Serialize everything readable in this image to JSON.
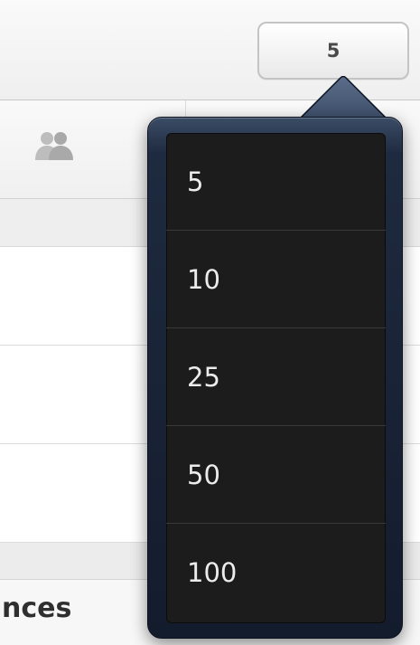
{
  "toolbar": {
    "page_size_button_label": "5"
  },
  "header": {
    "users_icon": "users-icon"
  },
  "section": {
    "title_partial": "nces"
  },
  "popover": {
    "items": [
      {
        "label": "5"
      },
      {
        "label": "10"
      },
      {
        "label": "25"
      },
      {
        "label": "50"
      },
      {
        "label": "100"
      }
    ]
  },
  "colors": {
    "popover_frame": "#1e2a3f",
    "popover_list_bg": "#1c1c1c",
    "popover_text": "#ececec"
  }
}
